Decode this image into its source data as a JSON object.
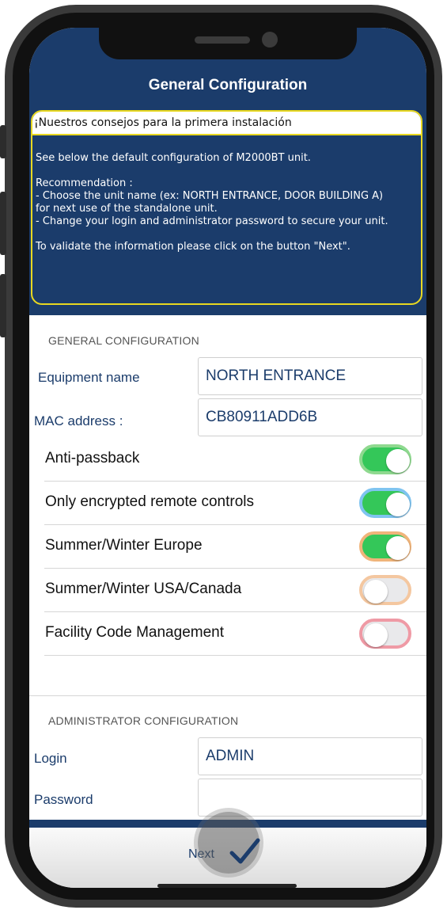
{
  "app": {
    "title": "General Configuration"
  },
  "banner": {
    "title": "¡Nuestros consejos para la primera instalación",
    "lines": [
      "See below the default configuration of M2000BT unit.",
      "",
      "Recommendation :",
      " - Choose the unit name (ex: NORTH ENTRANCE, DOOR BUILDING A)",
      "for next use of the standalone unit.",
      "- Change your login and administrator password to secure your unit.",
      "",
      "To validate the information please click on the button \"Next\"."
    ]
  },
  "general": {
    "section_label": "GENERAL CONFIGURATION",
    "equipment_name": {
      "label": "Equipment name",
      "value": "NORTH ENTRANCE"
    },
    "mac_address": {
      "label": "MAC address :",
      "value": "CB80911ADD6B"
    },
    "toggles": [
      {
        "label": "Anti-passback",
        "on": true,
        "ring_color": "#8fd98f"
      },
      {
        "label": "Only encrypted remote controls",
        "on": true,
        "ring_color": "#7fc4f0"
      },
      {
        "label": "Summer/Winter Europe",
        "on": true,
        "ring_color": "#f0b47a"
      },
      {
        "label": "Summer/Winter USA/Canada",
        "on": false,
        "ring_color": "#f4c7a0"
      },
      {
        "label": "Facility Code Management",
        "on": false,
        "ring_color": "#ef9aa5"
      }
    ]
  },
  "admin": {
    "section_label": "ADMINISTRATOR CONFIGURATION",
    "login": {
      "label": "Login",
      "value": "ADMIN"
    },
    "password": {
      "label": "Password",
      "value": ""
    }
  },
  "footer": {
    "next_label": "Next"
  },
  "colors": {
    "header_bg": "#1b3c6b",
    "toggle_on": "#34c759",
    "banner_border": "#e8d820"
  }
}
